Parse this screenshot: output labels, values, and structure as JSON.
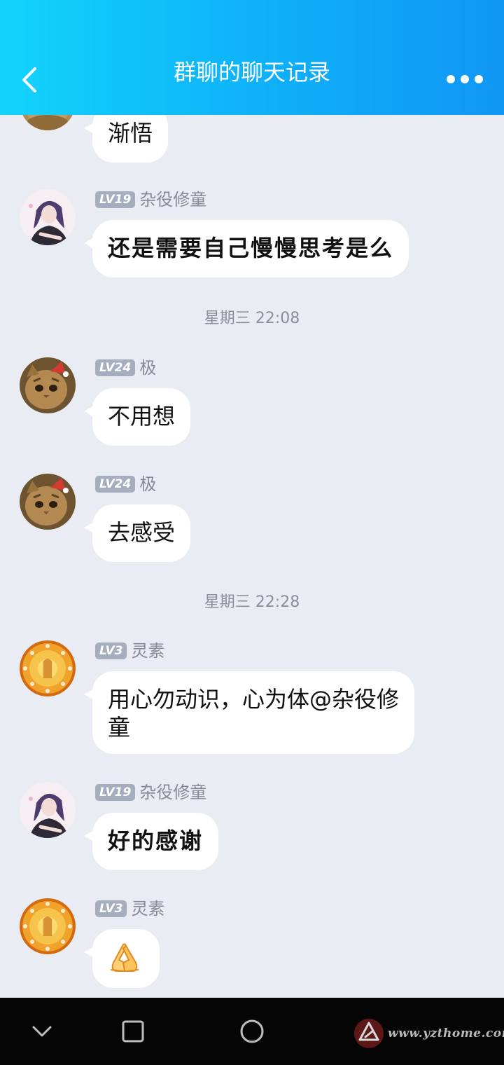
{
  "header": {
    "title": "群聊的聊天记录",
    "back_icon": "chevron-left-icon",
    "more_icon": "more-dots-icon",
    "gradient": [
      "#12d4fb",
      "#1096f6"
    ]
  },
  "messages": [
    {
      "text": "渐悟"
    },
    {
      "level": "LV19",
      "name": "杂役修童",
      "text": "还是需要自己慢慢思考是么"
    },
    {
      "time": "星期三 22:08"
    },
    {
      "level": "LV24",
      "name": "极",
      "text": "不用想"
    },
    {
      "level": "LV24",
      "name": "极",
      "text": "去感受"
    },
    {
      "time": "星期三 22:28"
    },
    {
      "level": "LV3",
      "name": "灵素",
      "text": "用心勿动识，心为体@杂役修童"
    },
    {
      "level": "LV19",
      "name": "杂役修童",
      "text": "好的感谢"
    },
    {
      "level": "LV3",
      "name": "灵素",
      "emoji": "folded-hands-icon"
    }
  ],
  "navbar": {
    "back_icon": "chevron-down-icon",
    "recents_icon": "square-icon",
    "home_icon": "circle-icon"
  },
  "watermark": {
    "text": "www.yzthome.com"
  },
  "colors": {
    "background": "#eaecf3",
    "bubble": "#ffffff",
    "badge": "#a6adbf",
    "navbar": "#050505"
  }
}
